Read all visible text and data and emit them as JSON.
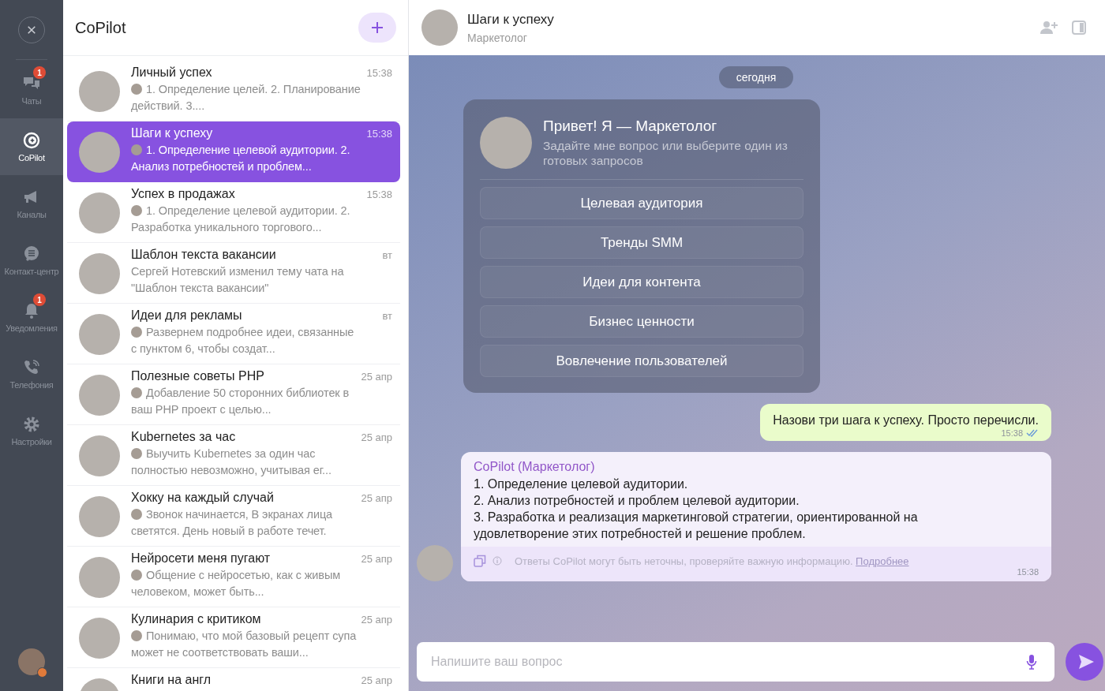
{
  "rail": {
    "items": [
      {
        "label": "Чаты",
        "selected": false,
        "badge": "1"
      },
      {
        "label": "CoPilot",
        "selected": true
      },
      {
        "label": "Каналы",
        "selected": false
      },
      {
        "label": "Контакт-центр",
        "selected": false
      },
      {
        "label": "Уведомления",
        "selected": false,
        "badge": "1"
      },
      {
        "label": "Телефония",
        "selected": false
      },
      {
        "label": "Настройки",
        "selected": false
      }
    ]
  },
  "chat_list": {
    "title": "CoPilot",
    "items": [
      {
        "title": "Личный успех",
        "time": "15:38",
        "preview": "1. Определение целей. 2. Планирование действий. 3....",
        "sender_avatar": true,
        "selected": false
      },
      {
        "title": "Шаги к успеху",
        "time": "15:38",
        "preview": "1. Определение целевой аудитории. 2. Анализ потребностей и проблем...",
        "sender_avatar": true,
        "selected": true
      },
      {
        "title": "Успех в продажах",
        "time": "15:38",
        "preview": "1. Определение целевой аудитории. 2. Разработка уникального торгового...",
        "sender_avatar": true,
        "selected": false
      },
      {
        "title": "Шаблон текста вакансии",
        "time": "вт",
        "preview": "Сергей Нотевский изменил тему чата на \"Шаблон текста вакансии\"",
        "sender_avatar": false,
        "selected": false
      },
      {
        "title": "Идеи для рекламы",
        "time": "вт",
        "preview": "Развернем подробнее идеи, связанные с пунктом 6, чтобы создат...",
        "sender_avatar": true,
        "selected": false
      },
      {
        "title": "Полезные советы PHP",
        "time": "25 апр",
        "preview": "Добавление 50 сторонних библиотек в ваш PHP проект с целью...",
        "sender_avatar": true,
        "selected": false
      },
      {
        "title": "Kubernetes за час",
        "time": "25 апр",
        "preview": "Выучить Kubernetes за один час полностью невозможно, учитывая ег...",
        "sender_avatar": true,
        "selected": false
      },
      {
        "title": "Хокку на каждый случай",
        "time": "25 апр",
        "preview": "Звонок начинается, В экранах лица светятся. День новый в работе течет.",
        "sender_avatar": true,
        "selected": false
      },
      {
        "title": "Нейросети меня пугают",
        "time": "25 апр",
        "preview": "Общение с нейросетью, как с живым человеком, может быть...",
        "sender_avatar": true,
        "selected": false
      },
      {
        "title": "Кулинария с критиком",
        "time": "25 апр",
        "preview": "Понимаю, что мой базовый рецепт супа может не соответствовать ваши...",
        "sender_avatar": true,
        "selected": false
      },
      {
        "title": "Книги на англ",
        "time": "25 апр",
        "selected": false
      }
    ]
  },
  "chat": {
    "title": "Шаги к успеху",
    "subtitle": "Маркетолог",
    "date": "сегодня",
    "welcome": {
      "title": "Привет! Я — Маркетолог",
      "subtitle": "Задайте мне вопрос или выберите один из готовых запросов",
      "prompts": [
        "Целевая аудитория",
        "Тренды SMM",
        "Идеи для контента",
        "Бизнес ценности",
        "Вовлечение пользователей"
      ]
    },
    "messages": [
      {
        "kind": "outgoing",
        "text": "Назови три шага к успеху. Просто перечисли.",
        "time": "15:38",
        "read": true
      },
      {
        "kind": "incoming",
        "sender": "CoPilot (Маркетолог)",
        "lines": [
          "1. Определение целевой аудитории.",
          "2. Анализ потребностей и проблем целевой аудитории.",
          "3. Разработка и реализация маркетинговой стратегии, ориентированной на удовлетворение этих потребностей и решение проблем."
        ],
        "disclaimer": "Ответы CoPilot могут быть неточны, проверяйте важную информацию.",
        "link": "Подробнее",
        "time": "15:38"
      }
    ],
    "input": {
      "placeholder": "Напишите ваш вопрос"
    }
  }
}
